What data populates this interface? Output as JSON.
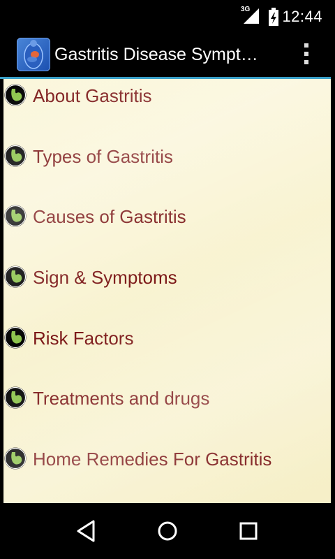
{
  "status_bar": {
    "network": "3G",
    "time": "12:44"
  },
  "action_bar": {
    "title": "Gastritis Disease Sympt…"
  },
  "menu": {
    "items": [
      {
        "label": "About Gastritis"
      },
      {
        "label": "Types of Gastritis"
      },
      {
        "label": "Causes of Gastritis"
      },
      {
        "label": "Sign & Symptoms"
      },
      {
        "label": "Risk Factors"
      },
      {
        "label": "Treatments and drugs"
      },
      {
        "label": "Home Remedies For Gastritis"
      }
    ]
  },
  "colors": {
    "accent": "#3aa0c8",
    "item_text": "#7a1515",
    "content_bg": "#fbf7dc"
  },
  "icons": {
    "bullet": "stomach-bullet-icon",
    "overflow": "overflow-menu-icon",
    "back": "back-icon",
    "home": "home-icon",
    "recents": "recents-icon"
  }
}
